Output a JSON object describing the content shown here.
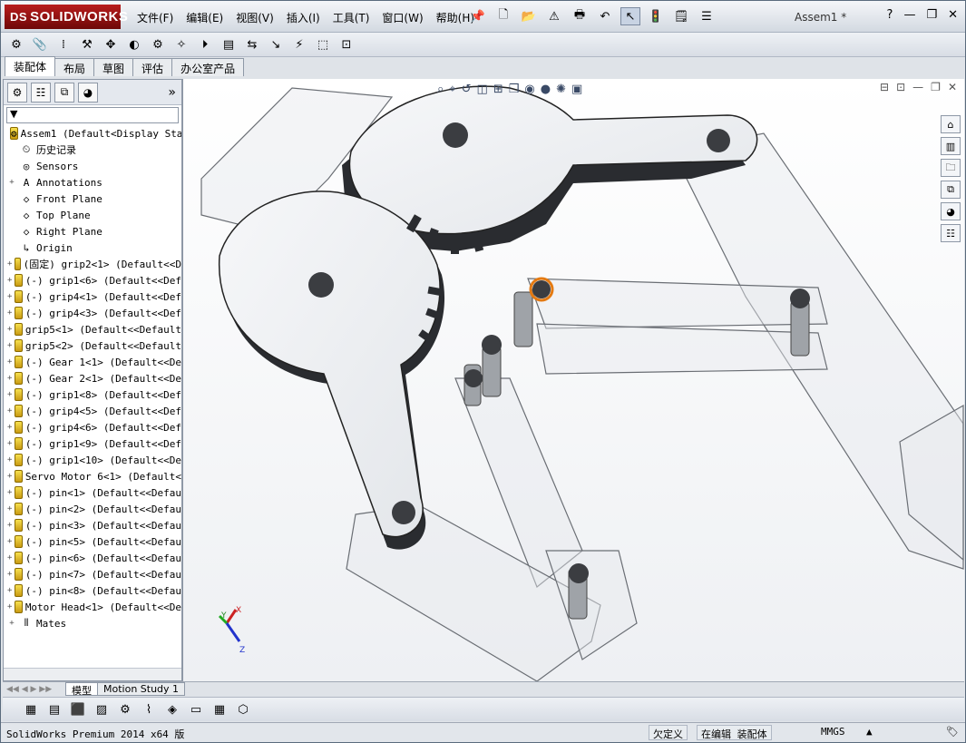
{
  "app": {
    "brand": "SOLIDWORKS",
    "doc_title": "Assem1 *"
  },
  "menu": [
    "文件(F)",
    "编辑(E)",
    "视图(V)",
    "插入(I)",
    "工具(T)",
    "窗口(W)",
    "帮助(H)"
  ],
  "tabs": [
    "装配体",
    "布局",
    "草图",
    "评估",
    "办公室产品"
  ],
  "filter_label": "▼",
  "tree": [
    {
      "expand": "",
      "icon": "assembly-icon",
      "glyph": "⚙",
      "label": "Assem1  (Default<Display Stat"
    },
    {
      "expand": "",
      "icon": "history-icon",
      "glyph": "⏲",
      "label": "历史记录"
    },
    {
      "expand": "",
      "icon": "sensor-icon",
      "glyph": "◎",
      "label": "Sensors"
    },
    {
      "expand": "+",
      "icon": "annotation-icon",
      "glyph": "A",
      "label": "Annotations"
    },
    {
      "expand": "",
      "icon": "plane-icon",
      "glyph": "◇",
      "label": "Front Plane"
    },
    {
      "expand": "",
      "icon": "plane-icon",
      "glyph": "◇",
      "label": "Top Plane"
    },
    {
      "expand": "",
      "icon": "plane-icon",
      "glyph": "◇",
      "label": "Right Plane"
    },
    {
      "expand": "",
      "icon": "origin-icon",
      "glyph": "↳",
      "label": "Origin"
    },
    {
      "expand": "+",
      "icon": "part-icon",
      "glyph": "",
      "label": "(固定) grip2<1> (Default<<D"
    },
    {
      "expand": "+",
      "icon": "part-icon",
      "glyph": "",
      "label": "(-) grip1<6> (Default<<Def"
    },
    {
      "expand": "+",
      "icon": "part-icon",
      "glyph": "",
      "label": "(-) grip4<1> (Default<<Def"
    },
    {
      "expand": "+",
      "icon": "part-icon",
      "glyph": "",
      "label": "(-) grip4<3> (Default<<Def"
    },
    {
      "expand": "+",
      "icon": "part-icon",
      "glyph": "",
      "label": "grip5<1> (Default<<Default"
    },
    {
      "expand": "+",
      "icon": "part-icon",
      "glyph": "",
      "label": "grip5<2> (Default<<Default"
    },
    {
      "expand": "+",
      "icon": "part-icon",
      "glyph": "",
      "label": "(-) Gear 1<1> (Default<<De"
    },
    {
      "expand": "+",
      "icon": "part-icon",
      "glyph": "",
      "label": "(-) Gear 2<1> (Default<<De"
    },
    {
      "expand": "+",
      "icon": "part-icon",
      "glyph": "",
      "label": "(-) grip1<8> (Default<<Def"
    },
    {
      "expand": "+",
      "icon": "part-icon",
      "glyph": "",
      "label": "(-) grip4<5> (Default<<Def"
    },
    {
      "expand": "+",
      "icon": "part-icon",
      "glyph": "",
      "label": "(-) grip4<6> (Default<<Def"
    },
    {
      "expand": "+",
      "icon": "part-icon",
      "glyph": "",
      "label": "(-) grip1<9> (Default<<Def"
    },
    {
      "expand": "+",
      "icon": "part-icon",
      "glyph": "",
      "label": "(-) grip1<10> (Default<<De"
    },
    {
      "expand": "+",
      "icon": "part-icon",
      "glyph": "",
      "label": "Servo Motor 6<1> (Default<"
    },
    {
      "expand": "+",
      "icon": "part-icon",
      "glyph": "",
      "label": "(-) pin<1> (Default<<Defau"
    },
    {
      "expand": "+",
      "icon": "part-icon",
      "glyph": "",
      "label": "(-) pin<2> (Default<<Defau"
    },
    {
      "expand": "+",
      "icon": "part-icon",
      "glyph": "",
      "label": "(-) pin<3> (Default<<Defau"
    },
    {
      "expand": "+",
      "icon": "part-icon",
      "glyph": "",
      "label": "(-) pin<5> (Default<<Defau"
    },
    {
      "expand": "+",
      "icon": "part-icon",
      "glyph": "",
      "label": "(-) pin<6> (Default<<Defau"
    },
    {
      "expand": "+",
      "icon": "part-icon",
      "glyph": "",
      "label": "(-) pin<7> (Default<<Defau"
    },
    {
      "expand": "+",
      "icon": "part-icon",
      "glyph": "",
      "label": "(-) pin<8> (Default<<Defau"
    },
    {
      "expand": "+",
      "icon": "part-icon",
      "glyph": "",
      "label": "Motor Head<1> (Default<<De"
    },
    {
      "expand": "+",
      "icon": "mates-icon",
      "glyph": "⫴",
      "label": "Mates"
    }
  ],
  "triad": {
    "x": "X",
    "y": "Y",
    "z": "Z"
  },
  "bottom_tabs": [
    "模型",
    "Motion Study 1"
  ],
  "status": {
    "product": "SolidWorks Premium 2014 x64 版",
    "state1": "欠定义",
    "state2": "在编辑 装配体",
    "units": "MMGS",
    "units_arrow": "▲"
  }
}
